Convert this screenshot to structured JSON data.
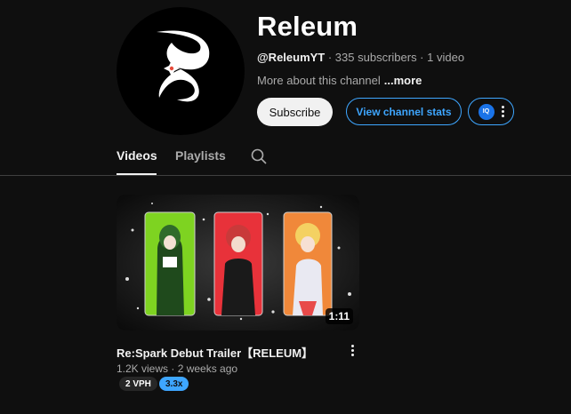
{
  "channel": {
    "name": "Releum",
    "handle": "@ReleumYT",
    "stats": " · 335 subscribers · 1 video",
    "about": "More about this channel",
    "about_more": "...more"
  },
  "actions": {
    "subscribe": "Subscribe",
    "view_stats": "View channel stats",
    "extension_icon": "IQ"
  },
  "tabs": [
    {
      "label": "Videos",
      "active": true
    },
    {
      "label": "Playlists",
      "active": false
    }
  ],
  "video": {
    "title": "Re:Spark Debut Trailer【RELEUM】",
    "views": "1.2K views",
    "age": "2 weeks ago",
    "duration": "1:11",
    "badges": [
      "2 VPH",
      "3.3x"
    ]
  },
  "colors": {
    "background": "#0f0f0f",
    "accent": "#3ea6ff",
    "panel_green": "#7ed321",
    "panel_red": "#e8323a",
    "panel_orange": "#f0883a"
  }
}
